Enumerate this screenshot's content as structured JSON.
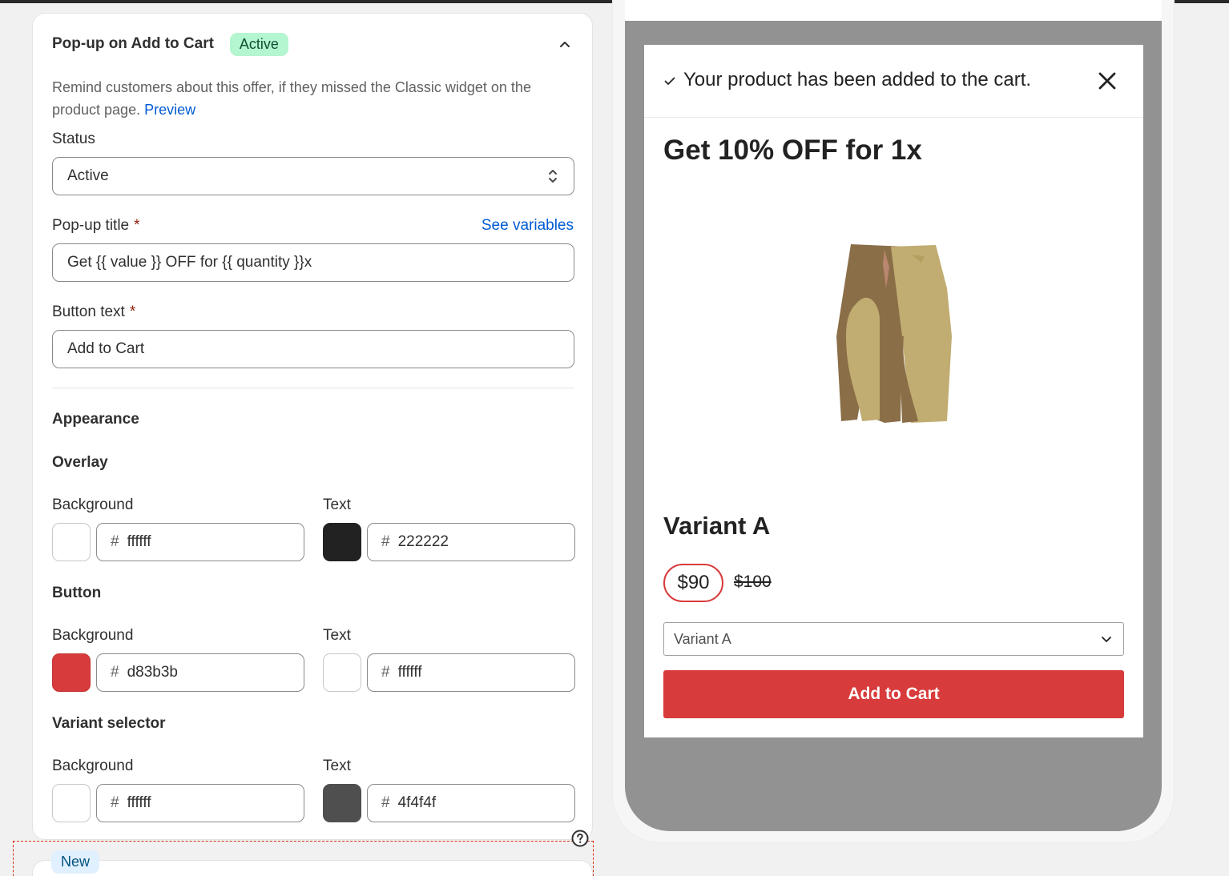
{
  "settings": {
    "title": "Pop-up on Add to Cart",
    "status_badge": "Active",
    "description": "Remind customers about this offer, if they missed the Classic widget on the product page.",
    "preview_link": "Preview",
    "status_label": "Status",
    "status_value": "Active",
    "popup_title_label": "Pop-up title",
    "required_mark": "*",
    "see_variables": "See variables",
    "popup_title_value": "Get {{ value }} OFF for {{ quantity }}x",
    "button_text_label": "Button text",
    "button_text_value": "Add to Cart",
    "appearance_heading": "Appearance",
    "hash": "#",
    "overlay": {
      "heading": "Overlay",
      "bg_label": "Background",
      "bg_hex": "ffffff",
      "bg_color": "#ffffff",
      "text_label": "Text",
      "text_hex": "222222",
      "text_color": "#222222"
    },
    "button": {
      "heading": "Button",
      "bg_label": "Background",
      "bg_hex": "d83b3b",
      "bg_color": "#d83b3b",
      "text_label": "Text",
      "text_hex": "ffffff",
      "text_color": "#ffffff"
    },
    "variant_selector": {
      "heading": "Variant selector",
      "bg_label": "Background",
      "bg_hex": "ffffff",
      "bg_color": "#ffffff",
      "text_label": "Text",
      "text_hex": "4f4f4f",
      "text_color": "#4f4f4f"
    },
    "new_badge": "New"
  },
  "preview": {
    "added_message": "Your product has been added to the cart.",
    "title": "Get 10% OFF for 1x",
    "variant_name": "Variant A",
    "price": "$90",
    "compare_price": "$100",
    "variant_option": "Variant A",
    "button_label": "Add to Cart"
  }
}
